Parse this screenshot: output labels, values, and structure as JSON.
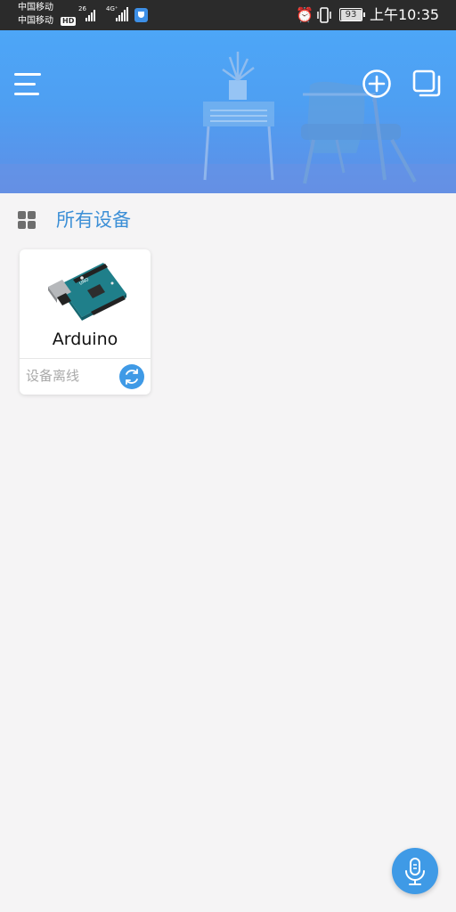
{
  "status_bar": {
    "carrier_1": "中国移动",
    "carrier_2": "中国移动",
    "hd_badge": "HD",
    "net_1": "26",
    "net_2": "4G⁺",
    "battery": "93",
    "time": "上午10:35",
    "icons": [
      "signal-icon",
      "shield-app-icon",
      "alarm-icon",
      "vibrate-icon",
      "battery-icon"
    ]
  },
  "header": {
    "menu_icon": "hamburger-menu-icon",
    "add_icon": "add-circle-icon",
    "copy_icon": "copy-icon"
  },
  "section": {
    "title": "所有设备",
    "icon": "grid-icon"
  },
  "devices": [
    {
      "name": "Arduino",
      "status": "设备离线",
      "image": "arduino-board-image",
      "action_icon": "refresh-icon"
    }
  ],
  "fab": {
    "icon": "microphone-icon"
  },
  "colors": {
    "accent": "#3f9ae6",
    "title_blue": "#3c8fd6",
    "header_top": "#4da6f7",
    "header_bottom": "#5f8ee6",
    "background": "#f5f4f5",
    "status_bar": "#2b2b2b"
  }
}
